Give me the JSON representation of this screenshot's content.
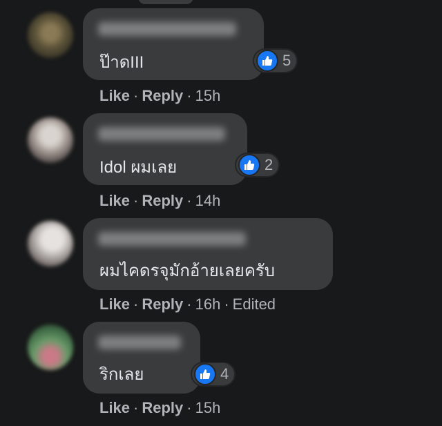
{
  "colors": {
    "background": "#18191a",
    "bubble": "#3a3b3c",
    "like_blue": "#1877f2",
    "meta_text": "#b0b3b8"
  },
  "comments": [
    {
      "text": "ป๊าดIII",
      "reaction": {
        "icon": "like-icon",
        "count": "5"
      },
      "actions": {
        "like": "Like",
        "reply": "Reply",
        "time": "15h",
        "edited": ""
      }
    },
    {
      "text": "Idol ผมเลย",
      "reaction": {
        "icon": "like-icon",
        "count": "2"
      },
      "actions": {
        "like": "Like",
        "reply": "Reply",
        "time": "14h",
        "edited": ""
      }
    },
    {
      "text": "ผมไคดรจุมักอ้ายเลยครับ",
      "reaction": null,
      "actions": {
        "like": "Like",
        "reply": "Reply",
        "time": "16h",
        "edited": "Edited"
      }
    },
    {
      "text": "ริกเลย",
      "reaction": {
        "icon": "like-icon",
        "count": "4"
      },
      "actions": {
        "like": "Like",
        "reply": "Reply",
        "time": "15h",
        "edited": ""
      }
    }
  ]
}
